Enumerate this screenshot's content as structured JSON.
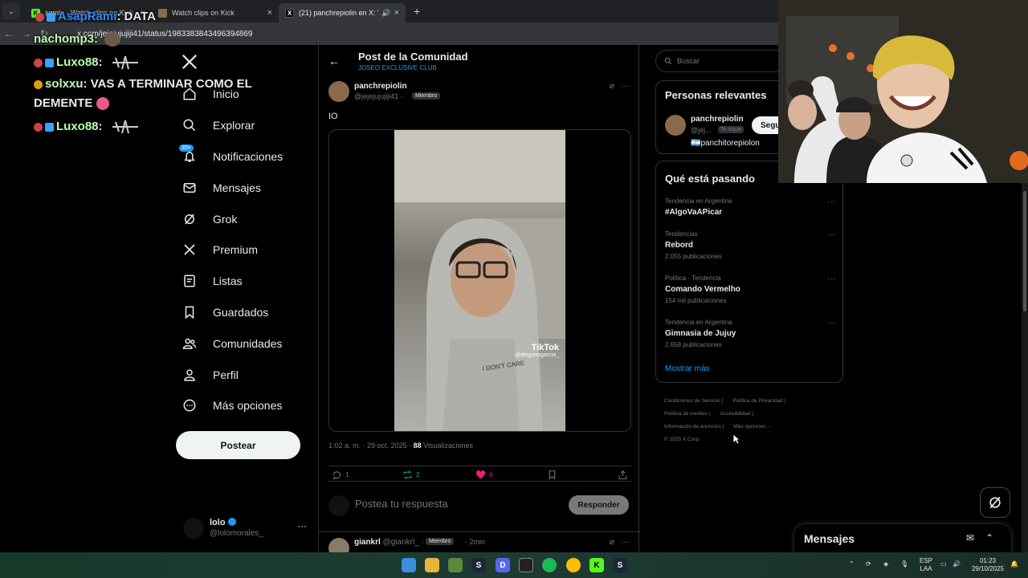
{
  "browser": {
    "tabs": [
      {
        "title": "sgmlo - Watch clips on Kick",
        "favicon": "K",
        "color": "#53fc18"
      },
      {
        "title": "Watch clips on Kick",
        "favicon": "",
        "color": "#8a6a4a"
      },
      {
        "title": "(21) panchrepiolin en X: \"IO",
        "favicon": "X",
        "color": "#ffffff"
      }
    ],
    "url": "x.com/jejejujujiji41/status/1983383843496394869",
    "new_tab": "+"
  },
  "chat": {
    "messages": [
      {
        "user": "AsapRami",
        "text": ": DATA"
      },
      {
        "user": "nachomp3",
        "text": ":"
      },
      {
        "user": "Luxo88",
        "text": ":"
      },
      {
        "user": "solxxu",
        "text": ": VAS A TERMINAR COMO EL"
      },
      {
        "user": "",
        "text": "DEMENTE"
      },
      {
        "user": "Luxo88",
        "text": ":"
      }
    ]
  },
  "nav": {
    "items": [
      {
        "label": "Inicio",
        "icon": "home-icon"
      },
      {
        "label": "Explorar",
        "icon": "search-icon"
      },
      {
        "label": "Notificaciones",
        "icon": "bell-icon",
        "badge": "20+"
      },
      {
        "label": "Mensajes",
        "icon": "mail-icon"
      },
      {
        "label": "Grok",
        "icon": "grok-icon"
      },
      {
        "label": "Premium",
        "icon": "x-icon"
      },
      {
        "label": "Listas",
        "icon": "list-icon"
      },
      {
        "label": "Guardados",
        "icon": "bookmark-icon"
      },
      {
        "label": "Comunidades",
        "icon": "people-icon"
      },
      {
        "label": "Perfil",
        "icon": "person-icon"
      },
      {
        "label": "Más opciones",
        "icon": "more-icon"
      }
    ],
    "post_button": "Postear",
    "account": {
      "name": "lolo",
      "handle": "@lolomorales_",
      "more": "···"
    }
  },
  "post": {
    "header_title": "Post de la Comunidad",
    "community": "JOSEO EXCLUSIVE CLUB",
    "author_name": "panchrepiolin",
    "author_handle": "@jejejujujiji41 ·",
    "member_label": "Miembro",
    "text": "IO",
    "watermark": "TikTok",
    "watermark_handle": "@diegooogarcia_",
    "time": "1:02 a. m. · 29 oct. 2025 ·",
    "views_count": "88",
    "views_label": "Visualizaciones",
    "stats": {
      "replies": "1",
      "reposts": "2",
      "likes": "6"
    },
    "reply_placeholder": "Postea tu respuesta",
    "reply_button": "Responder"
  },
  "comment": {
    "name": "giankrl",
    "handle": "@giankrl_ ·",
    "member_label": "Miembro",
    "time": "· 2min"
  },
  "right": {
    "search_placeholder": "Buscar",
    "relevant_title": "Personas relevantes",
    "relevant_user": {
      "name": "panchrepiolin",
      "handle": "@jej...",
      "follows_you": "Te sigue",
      "bio": "🇦🇷panchitorepiolon",
      "follow_button": "Seguir"
    },
    "trends_title": "Qué está pasando",
    "trends": [
      {
        "context": "Tendencia en Argentina",
        "title": "#AlgoVaAPicar",
        "count": ""
      },
      {
        "context": "Tendencias",
        "title": "Rebord",
        "count": "2.055 publicaciones"
      },
      {
        "context": "Política · Tendencia",
        "title": "Comando Vermelho",
        "count": "154 mil publicaciones"
      },
      {
        "context": "Tendencia en Argentina",
        "title": "Gimnasia de Jujuy",
        "count": "2.658 publicaciones"
      }
    ],
    "show_more": "Mostrar más",
    "footer": [
      "Condiciones de Servicio |",
      "Política de Privacidad |",
      "Política de cookies |",
      "Accesibilidad |",
      "Información de anuncios |",
      "Más opciones ···",
      "© 2025 X Corp."
    ]
  },
  "messages_dock": {
    "title": "Mensajes"
  },
  "taskbar": {
    "lang": "ESP",
    "layout": "LAA",
    "time": "01:23",
    "date": "29/10/2025"
  },
  "colors": {
    "accent": "#1d9bf0",
    "like": "#f91880",
    "repost": "#00ba7c"
  }
}
